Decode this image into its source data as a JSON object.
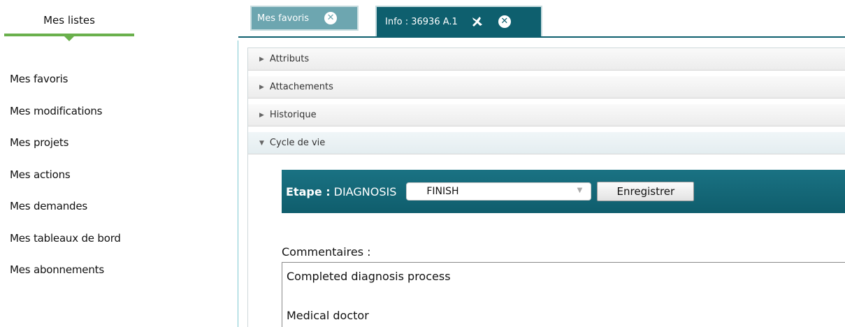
{
  "sidebar": {
    "title": "Mes listes",
    "items": [
      {
        "label": "Mes favoris"
      },
      {
        "label": "Mes modifications"
      },
      {
        "label": "Mes projets"
      },
      {
        "label": "Mes actions"
      },
      {
        "label": "Mes demandes"
      },
      {
        "label": "Mes tableaux de bord"
      },
      {
        "label": "Mes abonnements"
      }
    ]
  },
  "tabs": [
    {
      "label": "Mes favoris",
      "icon": "close-icon"
    },
    {
      "label": "Info : 36936 A.1",
      "icon": "pin-icon"
    }
  ],
  "accordion": {
    "attributs": "Attributs",
    "attachements": "Attachements",
    "historique": "Historique",
    "cycle": "Cycle de vie"
  },
  "etape": {
    "label": "Etape :",
    "value": "DIAGNOSIS",
    "select_value": "FINISH",
    "save_button": "Enregistrer"
  },
  "comments": {
    "label": "Commentaires :",
    "line1": "Completed diagnosis process",
    "line2": "Medical doctor"
  },
  "colors": {
    "accent_green": "#6ab04c",
    "tab_active": "#0e5f6e",
    "tab_inactive": "#6da6b0"
  }
}
